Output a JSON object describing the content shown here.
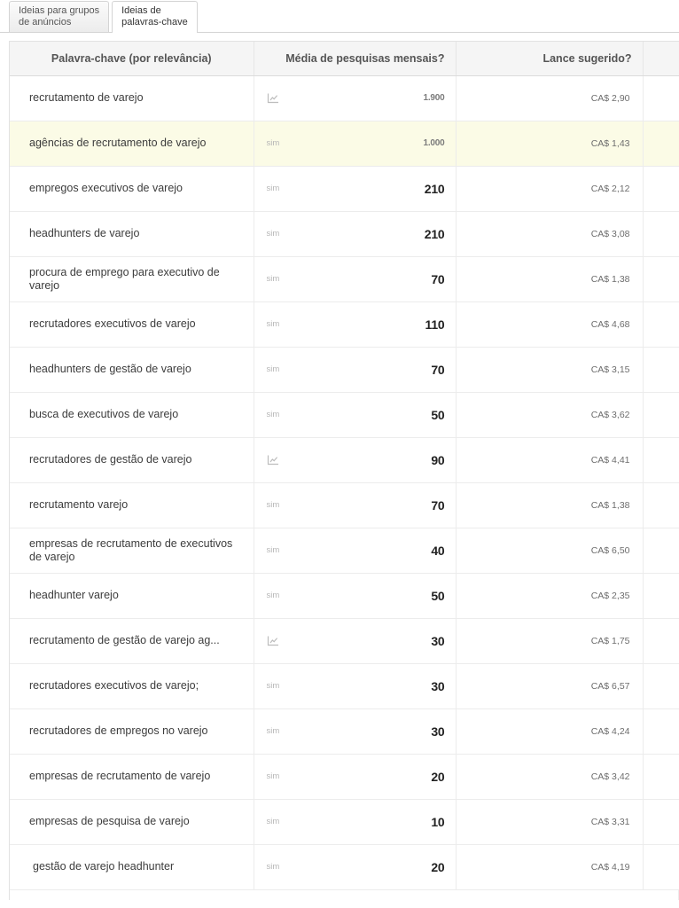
{
  "tabs": [
    {
      "label": "Ideias para grupos\nde anúncios",
      "active": false,
      "name": "tab-ad-group-ideas"
    },
    {
      "label": "Ideias de\npalavras-chave",
      "active": true,
      "name": "tab-keyword-ideas"
    }
  ],
  "table": {
    "columns": {
      "keyword": "Palavra-chave (por relevância)",
      "volume": "Média de pesquisas mensais?",
      "bid": "Lance sugerido?"
    },
    "rows": [
      {
        "keyword": "recrutamento de varejo",
        "indicator": "chart-icon",
        "volume": "1.900",
        "volume_faint": true,
        "bid": "CA$ 2,90",
        "highlight": false,
        "indent": false
      },
      {
        "keyword": "agências de recrutamento de varejo",
        "indicator": "sim",
        "volume": "1.000",
        "volume_faint": true,
        "bid": "CA$ 1,43",
        "highlight": true,
        "indent": false
      },
      {
        "keyword": "empregos executivos de varejo",
        "indicator": "sim",
        "volume": "210",
        "volume_faint": false,
        "bid": "CA$ 2,12",
        "highlight": false,
        "indent": false
      },
      {
        "keyword": "headhunters de varejo",
        "indicator": "sim",
        "volume": "210",
        "volume_faint": false,
        "bid": "CA$ 3,08",
        "highlight": false,
        "indent": false
      },
      {
        "keyword": "procura de emprego para executivo de varejo",
        "indicator": "sim",
        "volume": "70",
        "volume_faint": false,
        "bid": "CA$ 1,38",
        "highlight": false,
        "indent": false
      },
      {
        "keyword": "recrutadores executivos de varejo",
        "indicator": "sim",
        "volume": "110",
        "volume_faint": false,
        "bid": "CA$ 4,68",
        "highlight": false,
        "indent": false
      },
      {
        "keyword": "headhunters de gestão de varejo",
        "indicator": "sim",
        "volume": "70",
        "volume_faint": false,
        "bid": "CA$ 3,15",
        "highlight": false,
        "indent": false
      },
      {
        "keyword": "busca de executivos de varejo",
        "indicator": "sim",
        "volume": "50",
        "volume_faint": false,
        "bid": "CA$ 3,62",
        "highlight": false,
        "indent": false
      },
      {
        "keyword": "recrutadores de gestão de varejo",
        "indicator": "chart-icon",
        "volume": "90",
        "volume_faint": false,
        "bid": "CA$ 4,41",
        "highlight": false,
        "indent": false
      },
      {
        "keyword": "recrutamento varejo",
        "indicator": "sim",
        "volume": "70",
        "volume_faint": false,
        "bid": "CA$ 1,38",
        "highlight": false,
        "indent": false
      },
      {
        "keyword": "empresas de recrutamento de executivos de varejo",
        "indicator": "sim",
        "volume": "40",
        "volume_faint": false,
        "bid": "CA$ 6,50",
        "highlight": false,
        "indent": false
      },
      {
        "keyword": "headhunter varejo",
        "indicator": "sim",
        "volume": "50",
        "volume_faint": false,
        "bid": "CA$ 2,35",
        "highlight": false,
        "indent": false
      },
      {
        "keyword": "recrutamento de gestão de varejo ag...",
        "indicator": "chart-icon",
        "volume": "30",
        "volume_faint": false,
        "bid": "CA$ 1,75",
        "highlight": false,
        "indent": false
      },
      {
        "keyword": "recrutadores executivos de varejo;",
        "indicator": "sim",
        "volume": "30",
        "volume_faint": false,
        "bid": "CA$ 6,57",
        "highlight": false,
        "indent": false
      },
      {
        "keyword": "recrutadores de empregos no varejo",
        "indicator": "sim",
        "volume": "30",
        "volume_faint": false,
        "bid": "CA$ 4,24",
        "highlight": false,
        "indent": false
      },
      {
        "keyword": "empresas de recrutamento de varejo",
        "indicator": "sim",
        "volume": "20",
        "volume_faint": false,
        "bid": "CA$ 3,42",
        "highlight": false,
        "indent": false
      },
      {
        "keyword": "empresas de pesquisa de varejo",
        "indicator": "sim",
        "volume": "10",
        "volume_faint": false,
        "bid": "CA$ 3,31",
        "highlight": false,
        "indent": false
      },
      {
        "keyword": "gestão de varejo headhunter",
        "indicator": "sim",
        "volume": "20",
        "volume_faint": false,
        "bid": "CA$ 4,19",
        "highlight": false,
        "indent": true
      }
    ]
  },
  "colors": {
    "highlight_row": "#fbfbe6",
    "header_bg": "#f5f5f5",
    "border": "#ececec",
    "text": "#3c3c3c",
    "muted": "#b6b6b6"
  }
}
